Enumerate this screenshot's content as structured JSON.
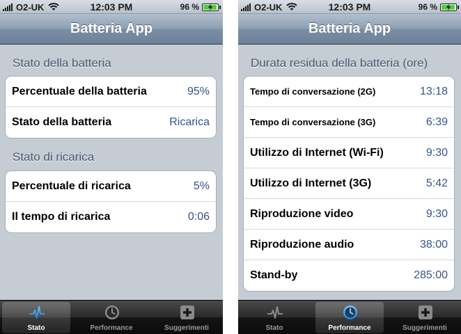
{
  "status_bar": {
    "carrier": "O2-UK",
    "time": "12:03 PM",
    "battery_percent": "96 %"
  },
  "left_screen": {
    "nav_title": "Batteria App",
    "sections": [
      {
        "header": "Stato della batteria",
        "rows": [
          {
            "label": "Percentuale della batteria",
            "value": "95%"
          },
          {
            "label": "Stato della batteria",
            "value": "Ricarica"
          }
        ]
      },
      {
        "header": "Stato di ricarica",
        "rows": [
          {
            "label": "Percentuale di ricarica",
            "value": "5%"
          },
          {
            "label": "Il tempo di ricarica",
            "value": "0:06"
          }
        ]
      }
    ],
    "active_tab": 0
  },
  "right_screen": {
    "nav_title": "Batteria App",
    "sections": [
      {
        "header": "Durata residua della batteria (ore)",
        "rows": [
          {
            "label": "Tempo di conversazione (2G)",
            "value": "13:18"
          },
          {
            "label": "Tempo di conversazione (3G)",
            "value": "6:39"
          },
          {
            "label": "Utilizzo di Internet (Wi-Fi)",
            "value": "9:30"
          },
          {
            "label": "Utilizzo di Internet (3G)",
            "value": "5:42"
          },
          {
            "label": "Riproduzione video",
            "value": "9:30"
          },
          {
            "label": "Riproduzione audio",
            "value": "38:00"
          },
          {
            "label": "Stand-by",
            "value": "285:00"
          }
        ]
      }
    ],
    "active_tab": 1
  },
  "tabs": [
    {
      "label": "Stato",
      "icon": "pulse-icon"
    },
    {
      "label": "Performance",
      "icon": "clock-icon"
    },
    {
      "label": "Suggerimenti",
      "icon": "plus-icon"
    }
  ],
  "colors": {
    "value_text": "#385487",
    "section_header": "#4c566c",
    "battery_fill": "#4cd137"
  }
}
